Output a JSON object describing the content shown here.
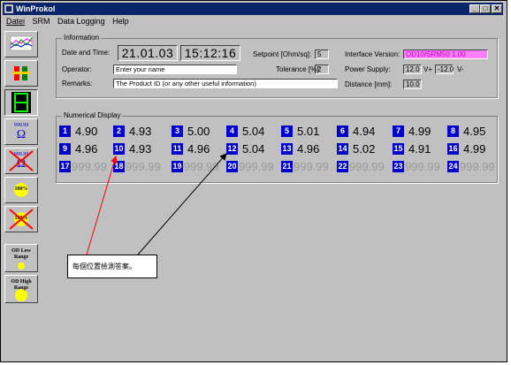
{
  "window": {
    "title": "WinProkol"
  },
  "titlebar_buttons": {
    "minimize": "_",
    "maximize": "□",
    "close": "✕"
  },
  "menu": [
    "Datei",
    "SRM",
    "Data Logging",
    "Help"
  ],
  "toolbar": [
    {
      "name": "chart",
      "label": ""
    },
    {
      "name": "multimeter",
      "label": ""
    },
    {
      "name": "digit-display",
      "label": ""
    },
    {
      "name": "ohm",
      "label": "999.99",
      "symbol": "Ω"
    },
    {
      "name": "ohm-off",
      "label": "999.99",
      "symbol": "Ω"
    },
    {
      "name": "percent",
      "label": "100%"
    },
    {
      "name": "percent-off",
      "label": "100%"
    },
    {
      "name": "od-low",
      "label": "OD Low Range"
    },
    {
      "name": "od-high",
      "label": "OD High Range"
    }
  ],
  "info": {
    "caption": "Information",
    "date_time_label": "Date and Time:",
    "date": "21.01.03",
    "time": "15:12:16",
    "operator_label": "Operator:",
    "operator_value": "Enter your name",
    "remarks_label": "Remarks:",
    "remarks_value": "The Product ID (or any other useful information)",
    "setpoint_label": "Setpoint [Ohm/sq]:",
    "setpoint_value": "5",
    "tolerance_label": "Tolerance [%]:",
    "tolerance_value": "2",
    "interface_label": "Interface Version:",
    "interface_value": "OD10/SRM50 1.00",
    "power_label": "Power Supply:",
    "power_plus": "12.0",
    "power_plus_unit": "V+",
    "power_minus": "-12.0",
    "power_minus_unit": "V-",
    "distance_label": "Distance [mm]:",
    "distance_value": "10.0"
  },
  "numerical": {
    "caption": "Numerical Display",
    "cells": [
      {
        "n": "1",
        "v": "4.90"
      },
      {
        "n": "2",
        "v": "4.93"
      },
      {
        "n": "3",
        "v": "5.00"
      },
      {
        "n": "4",
        "v": "5.04"
      },
      {
        "n": "5",
        "v": "5.01"
      },
      {
        "n": "6",
        "v": "4.94"
      },
      {
        "n": "7",
        "v": "4.99"
      },
      {
        "n": "8",
        "v": "4.95"
      },
      {
        "n": "9",
        "v": "4.96"
      },
      {
        "n": "10",
        "v": "4.93"
      },
      {
        "n": "11",
        "v": "4.96"
      },
      {
        "n": "12",
        "v": "5.04"
      },
      {
        "n": "13",
        "v": "4.96"
      },
      {
        "n": "14",
        "v": "5.02"
      },
      {
        "n": "15",
        "v": "4.91"
      },
      {
        "n": "16",
        "v": "4.99"
      },
      {
        "n": "17",
        "v": "999.99"
      },
      {
        "n": "18",
        "v": "999.99"
      },
      {
        "n": "19",
        "v": "999.99"
      },
      {
        "n": "20",
        "v": "999.99"
      },
      {
        "n": "21",
        "v": "999.99"
      },
      {
        "n": "22",
        "v": "999.99"
      },
      {
        "n": "23",
        "v": "999.99"
      },
      {
        "n": "24",
        "v": "999.99"
      }
    ]
  },
  "annotation": {
    "text": "每個位置檢測答案。"
  },
  "colors": {
    "badge": "#0000cc",
    "interface_bg": "#ff80ff",
    "interface_text": "#c000c0",
    "arrow_red": "#ff0000",
    "arrow_black": "#000000"
  }
}
